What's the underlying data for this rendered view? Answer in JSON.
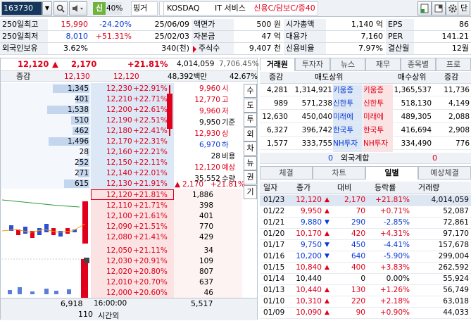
{
  "toolbar": {
    "code": "163730",
    "signal": "신",
    "margin": "40%",
    "name": "핑거",
    "market": "KOSDAQ",
    "sector": "IT 서비스",
    "credit": "신용C/담보C/증40",
    "right_btn": "단"
  },
  "info": {
    "r1": {
      "l1": "250일최고",
      "v1": "15,990",
      "p1": "-24.20%",
      "d1": "25/06/09",
      "l2": "액면가",
      "v2": "500 원",
      "l3": "시가총액",
      "v3": "1,140 억",
      "l4": "EPS",
      "v4": "86"
    },
    "r2": {
      "l1": "250일최저",
      "v1": "8,010",
      "p1": "+51.31%",
      "d1": "25/02/03",
      "l2": "자본금",
      "v2": "47 억",
      "l3": "대용가",
      "v3": "7,160",
      "l4": "PER",
      "v4": "141.21"
    },
    "r3": {
      "l1": "외국인보유",
      "v1": "3.62%",
      "d1": "340(천)",
      "l2": "주식수",
      "v2": "9,407 천",
      "l3": "신용비율",
      "v3": "7.97%",
      "l4": "결산월",
      "v4": "12월"
    }
  },
  "price": {
    "current": "12,120",
    "change": "2,170",
    "rate": "+21.81%",
    "volume": "4,014,059",
    "vol_rate": "7,706.45%",
    "label": "증감",
    "cur2": "12,130",
    "cur3": "12,120",
    "amount": "48,392백만",
    "pct": "42.67%"
  },
  "asks": [
    {
      "qty": "1,345",
      "price": "12,230",
      "rate": "+22.91%"
    },
    {
      "qty": "401",
      "price": "12,210",
      "rate": "+22.71%"
    },
    {
      "qty": "1,538",
      "price": "12,200",
      "rate": "+22.61%"
    },
    {
      "qty": "510",
      "price": "12,190",
      "rate": "+22.51%"
    },
    {
      "qty": "462",
      "price": "12,180",
      "rate": "+22.41%"
    },
    {
      "qty": "1,496",
      "price": "12,170",
      "rate": "+22.31%"
    },
    {
      "qty": "28",
      "price": "12,160",
      "rate": "+22.21%"
    },
    {
      "qty": "252",
      "price": "12,150",
      "rate": "+22.11%"
    },
    {
      "qty": "271",
      "price": "12,140",
      "rate": "+22.01%"
    },
    {
      "qty": "615",
      "price": "12,130",
      "rate": "+21.91%"
    }
  ],
  "bids": [
    {
      "qty": "1,886",
      "price": "12,120",
      "rate": "+21.81%"
    },
    {
      "qty": "398",
      "price": "12,110",
      "rate": "+21.71%"
    },
    {
      "qty": "401",
      "price": "12,100",
      "rate": "+21.61%"
    },
    {
      "qty": "770",
      "price": "12,090",
      "rate": "+21.51%"
    },
    {
      "qty": "429",
      "price": "12,080",
      "rate": "+21.41%"
    },
    {
      "qty": "34",
      "price": "12,050",
      "rate": "+21.11%"
    },
    {
      "qty": "109",
      "price": "12,030",
      "rate": "+20.91%"
    },
    {
      "qty": "807",
      "price": "12,020",
      "rate": "+20.80%"
    },
    {
      "qty": "637",
      "price": "12,010",
      "rate": "+20.70%"
    },
    {
      "qty": "46",
      "price": "12,000",
      "rate": "+20.60%"
    }
  ],
  "side_info": [
    {
      "v": "9,960",
      "k": "시",
      "c": "red"
    },
    {
      "v": "12,770",
      "k": "고",
      "c": "red"
    },
    {
      "v": "9,960",
      "k": "저",
      "c": "red"
    },
    {
      "v": "9,950",
      "k": "기준",
      "c": ""
    },
    {
      "v": "12,930",
      "k": "상",
      "c": "red"
    },
    {
      "v": "6,970",
      "k": "하",
      "c": "blue"
    },
    {
      "v": "28",
      "k": "비용",
      "c": ""
    },
    {
      "v": "12,120",
      "k": "예상",
      "c": "red"
    },
    {
      "v": "35,552",
      "k": "수량",
      "c": ""
    }
  ],
  "exp": {
    "change": "2,170",
    "rate": "+21.81%"
  },
  "side_tabs": [
    "수",
    "도",
    "투",
    "외",
    "차",
    "뉴",
    "권",
    "기"
  ],
  "footer": {
    "ask_total": "6,918",
    "time": "16:00:00",
    "bid_total": "5,517",
    "after_qty": "110",
    "after_label": "시간외"
  },
  "broker_tabs": [
    "거래원",
    "투자자",
    "뉴스",
    "재무",
    "종목별",
    "프로"
  ],
  "broker": {
    "h_change": "증감",
    "h_sell": "매도상위",
    "h_buy": "매수상위",
    "h_change2": "증감",
    "rows": [
      {
        "c1": "4,281",
        "q1": "1,314,921",
        "n1": "키움증",
        "n2": "키움증",
        "q2": "1,365,537",
        "c2": "11,736"
      },
      {
        "c1": "989",
        "q1": "571,238",
        "n1": "신한투",
        "n2": "신한투",
        "q2": "518,130",
        "c2": "4,149"
      },
      {
        "c1": "12,630",
        "q1": "450,040",
        "n1": "미래에",
        "n2": "미래에",
        "q2": "489,305",
        "c2": "2,088"
      },
      {
        "c1": "6,327",
        "q1": "396,742",
        "n1": "한국투",
        "n2": "한국투",
        "q2": "416,694",
        "c2": "2,908"
      },
      {
        "c1": "1,577",
        "q1": "333,755",
        "n1": "NH투자",
        "n2": "NH투자",
        "q2": "334,490",
        "c2": "776"
      }
    ],
    "foreign_label": "외국계합",
    "foreign_l": "0",
    "foreign_r": "0"
  },
  "daily_tabs": [
    "체결",
    "차트",
    "일별",
    "예상체결"
  ],
  "daily": {
    "headers": [
      "일자",
      "종가",
      "대비",
      "등락률",
      "거래량"
    ],
    "rows": [
      {
        "d": "01/23",
        "p": "12,120",
        "m": "up",
        "c": "2,170",
        "r": "+21.81%",
        "v": "4,014,059",
        "col": "red",
        "hl": true
      },
      {
        "d": "01/22",
        "p": "9,950",
        "m": "up",
        "c": "70",
        "r": "+0.71%",
        "v": "52,087",
        "col": "red"
      },
      {
        "d": "01/21",
        "p": "9,880",
        "m": "down",
        "c": "290",
        "r": "-2.85%",
        "v": "72,861",
        "col": "blue"
      },
      {
        "d": "01/20",
        "p": "10,170",
        "m": "up",
        "c": "420",
        "r": "+4.31%",
        "v": "97,170",
        "col": "red"
      },
      {
        "d": "01/17",
        "p": "9,750",
        "m": "down",
        "c": "450",
        "r": "-4.41%",
        "v": "157,678",
        "col": "blue"
      },
      {
        "d": "01/16",
        "p": "10,200",
        "m": "down",
        "c": "640",
        "r": "-5.90%",
        "v": "299,004",
        "col": "blue"
      },
      {
        "d": "01/15",
        "p": "10,840",
        "m": "up",
        "c": "400",
        "r": "+3.83%",
        "v": "262,592",
        "col": "red"
      },
      {
        "d": "01/14",
        "p": "10,440",
        "m": "none",
        "c": "0",
        "r": "0.00%",
        "v": "55,924",
        "col": ""
      },
      {
        "d": "01/13",
        "p": "10,440",
        "m": "up",
        "c": "130",
        "r": "+1.26%",
        "v": "56,749",
        "col": "red"
      },
      {
        "d": "01/10",
        "p": "10,310",
        "m": "up",
        "c": "220",
        "r": "+2.18%",
        "v": "63,018",
        "col": "red"
      },
      {
        "d": "01/09",
        "p": "10,090",
        "m": "up",
        "c": "90",
        "r": "+0.90%",
        "v": "44,033",
        "col": "red"
      }
    ]
  }
}
